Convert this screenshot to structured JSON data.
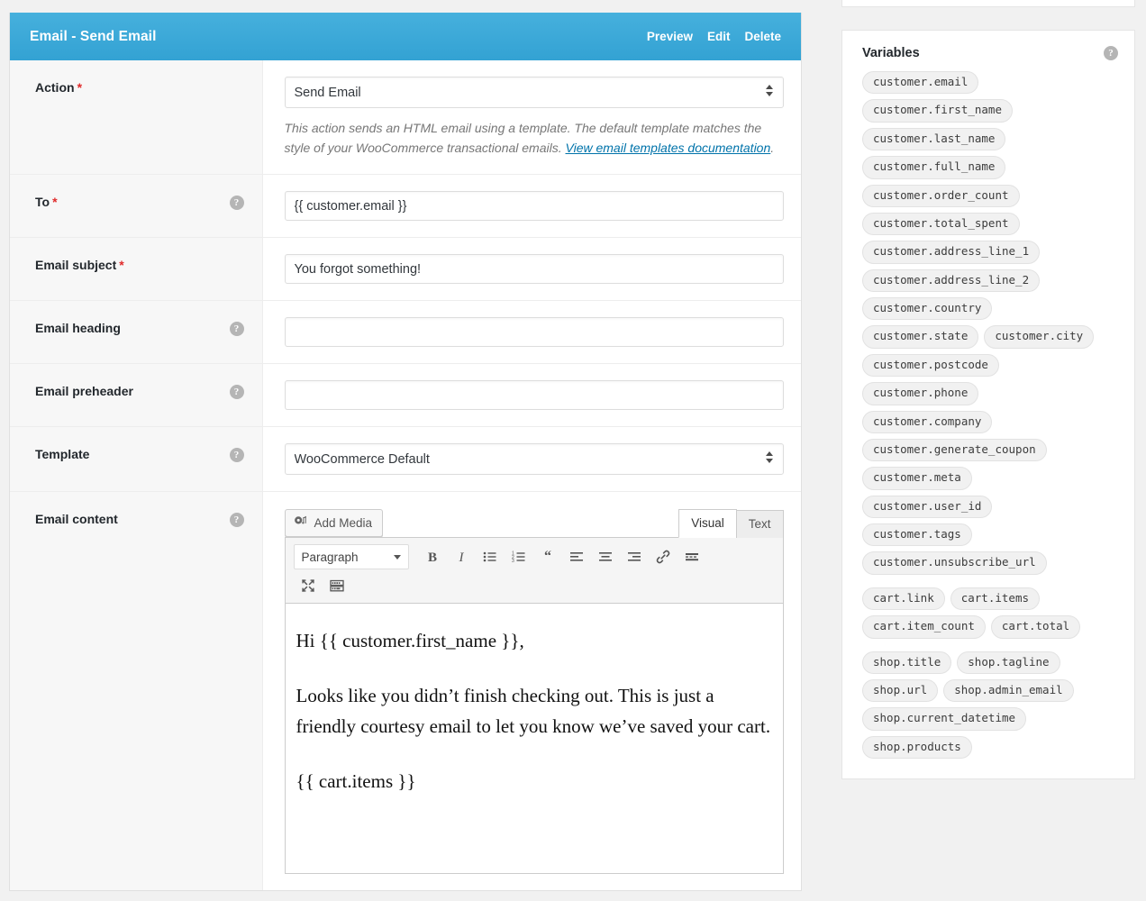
{
  "action_box": {
    "title": "Email - Send Email",
    "header_links": [
      "Preview",
      "Edit",
      "Delete"
    ],
    "accent_color": "#33a2d3",
    "required_marker": "*",
    "help_icon": "help-icon",
    "rows": {
      "action": {
        "label": "Action",
        "required": true,
        "has_help": false,
        "select_value": "Send Email",
        "description_before": "This action sends an HTML email using a template. The default template matches the style of your WooCommerce transactional emails. ",
        "description_link": "View email templates documentation",
        "description_after": "."
      },
      "to": {
        "label": "To",
        "required": true,
        "has_help": true,
        "value": "{{ customer.email }}",
        "placeholder": ""
      },
      "subject": {
        "label": "Email subject",
        "required": true,
        "has_help": false,
        "value": "You forgot something!",
        "placeholder": ""
      },
      "heading": {
        "label": "Email heading",
        "required": false,
        "has_help": true,
        "value": "",
        "placeholder": ""
      },
      "preheader": {
        "label": "Email preheader",
        "required": false,
        "has_help": true,
        "value": "",
        "placeholder": ""
      },
      "template": {
        "label": "Template",
        "required": false,
        "has_help": true,
        "select_value": "WooCommerce Default"
      },
      "content": {
        "label": "Email content",
        "required": false,
        "has_help": true
      }
    }
  },
  "editor": {
    "add_media_label": "Add Media",
    "add_media_icon": "add-media-icon",
    "tabs": [
      {
        "label": "Visual",
        "active": true
      },
      {
        "label": "Text",
        "active": false
      }
    ],
    "format_select": "Paragraph",
    "toolbar_row1": [
      "bold-icon",
      "italic-icon",
      "bulleted-list-icon",
      "numbered-list-icon",
      "blockquote-icon",
      "align-left-icon",
      "align-center-icon",
      "align-right-icon",
      "link-icon",
      "read-more-icon"
    ],
    "toolbar_row2": [
      "fullscreen-icon",
      "toolbar-toggle-icon"
    ],
    "content_paragraphs": [
      "Hi {{ customer.first_name }},",
      "Looks like you didn’t finish checking out. This is just a friendly courtesy email to let you know we’ve saved your cart.",
      "{{ cart.items }}"
    ]
  },
  "variables_panel": {
    "title": "Variables",
    "help_icon": "help-icon",
    "groups": [
      {
        "name": "customer",
        "rows": [
          [
            "customer.email"
          ],
          [
            "customer.first_name"
          ],
          [
            "customer.last_name"
          ],
          [
            "customer.full_name"
          ],
          [
            "customer.order_count"
          ],
          [
            "customer.total_spent"
          ],
          [
            "customer.address_line_1"
          ],
          [
            "customer.address_line_2"
          ],
          [
            "customer.country"
          ],
          [
            "customer.state",
            "customer.city"
          ],
          [
            "customer.postcode"
          ],
          [
            "customer.phone"
          ],
          [
            "customer.company"
          ],
          [
            "customer.generate_coupon"
          ],
          [
            "customer.meta"
          ],
          [
            "customer.user_id"
          ],
          [
            "customer.tags"
          ],
          [
            "customer.unsubscribe_url"
          ]
        ]
      },
      {
        "name": "cart",
        "rows": [
          [
            "cart.link",
            "cart.items"
          ],
          [
            "cart.item_count",
            "cart.total"
          ]
        ]
      },
      {
        "name": "shop",
        "rows": [
          [
            "shop.title",
            "shop.tagline"
          ],
          [
            "shop.url",
            "shop.admin_email"
          ],
          [
            "shop.current_datetime"
          ],
          [
            "shop.products"
          ]
        ]
      }
    ]
  }
}
